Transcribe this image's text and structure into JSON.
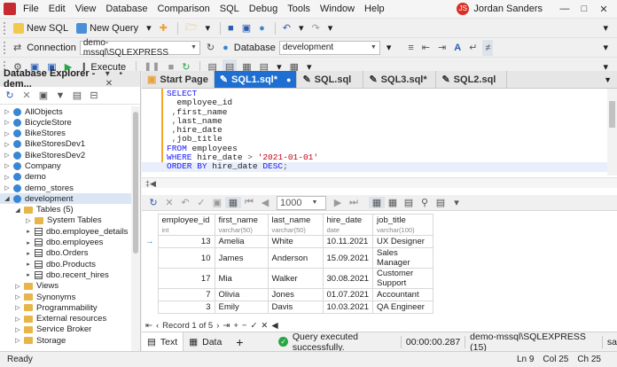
{
  "menu": [
    "File",
    "Edit",
    "View",
    "Database",
    "Comparison",
    "SQL",
    "Debug",
    "Tools",
    "Window",
    "Help"
  ],
  "user": {
    "initials": "JS",
    "name": "Jordan Sanders"
  },
  "toolbar1": {
    "new_sql": "New SQL",
    "new_query": "New Query"
  },
  "toolbar2": {
    "connection_label": "Connection",
    "connection_value": "demo-mssql\\SQLEXPRESS",
    "database_label": "Database",
    "database_value": "development"
  },
  "toolbar3": {
    "execute": "Execute"
  },
  "explorer": {
    "title": "Database Explorer - dem...",
    "items": [
      {
        "label": "AllObjects",
        "type": "db",
        "indent": 0
      },
      {
        "label": "BicycleStore",
        "type": "db",
        "indent": 0
      },
      {
        "label": "BikeStores",
        "type": "db",
        "indent": 0
      },
      {
        "label": "BikeStoresDev1",
        "type": "db",
        "indent": 0
      },
      {
        "label": "BikeStoresDev2",
        "type": "db",
        "indent": 0
      },
      {
        "label": "Company",
        "type": "db",
        "indent": 0
      },
      {
        "label": "demo",
        "type": "db",
        "indent": 0
      },
      {
        "label": "demo_stores",
        "type": "db",
        "indent": 0
      },
      {
        "label": "development",
        "type": "db",
        "indent": 0,
        "expanded": true,
        "selected": true
      },
      {
        "label": "Tables (5)",
        "type": "folder",
        "indent": 1,
        "expanded": true
      },
      {
        "label": "System Tables",
        "type": "folder",
        "indent": 2
      },
      {
        "label": "dbo.employee_details",
        "type": "table",
        "indent": 2
      },
      {
        "label": "dbo.employees",
        "type": "table",
        "indent": 2
      },
      {
        "label": "dbo.Orders",
        "type": "table",
        "indent": 2
      },
      {
        "label": "dbo.Products",
        "type": "table",
        "indent": 2
      },
      {
        "label": "dbo.recent_hires",
        "type": "table",
        "indent": 2
      },
      {
        "label": "Views",
        "type": "folder",
        "indent": 1
      },
      {
        "label": "Synonyms",
        "type": "folder",
        "indent": 1
      },
      {
        "label": "Programmability",
        "type": "folder",
        "indent": 1
      },
      {
        "label": "External resources",
        "type": "folder",
        "indent": 1
      },
      {
        "label": "Service Broker",
        "type": "folder",
        "indent": 1
      },
      {
        "label": "Storage",
        "type": "folder",
        "indent": 1
      }
    ]
  },
  "tabs": [
    "Start Page",
    "SQL1.sql*",
    "SQL.sql",
    "SQL3.sql*",
    "SQL2.sql"
  ],
  "active_tab": 1,
  "code": {
    "l1": "SELECT",
    "l2": "  employee_id",
    "l3a": " ,",
    "l3b": "first_name",
    "l4a": " ,",
    "l4b": "last_name",
    "l5a": " ,",
    "l5b": "hire_date",
    "l6a": " ,",
    "l6b": "job_title",
    "l7a": "FROM",
    "l7b": " employees",
    "l8a": "WHERE",
    "l8b": " hire_date ",
    "l8c": ">",
    "l8d": " '2021-01-01'",
    "l9a": "ORDER BY",
    "l9b": " hire_date ",
    "l9c": "DESC",
    ";": ";"
  },
  "results_toolbar": {
    "page_size": "1000"
  },
  "grid": {
    "columns": [
      {
        "name": "employee_id",
        "type": "int"
      },
      {
        "name": "first_name",
        "type": "varchar(50)"
      },
      {
        "name": "last_name",
        "type": "varchar(50)"
      },
      {
        "name": "hire_date",
        "type": "date"
      },
      {
        "name": "job_title",
        "type": "varchar(100)"
      }
    ],
    "rows": [
      [
        "13",
        "Amelia",
        "White",
        "10.11.2021",
        "UX Designer"
      ],
      [
        "10",
        "James",
        "Anderson",
        "15.09.2021",
        "Sales Manager"
      ],
      [
        "17",
        "Mia",
        "Walker",
        "30.08.2021",
        "Customer Support"
      ],
      [
        "7",
        "Olivia",
        "Jones",
        "01.07.2021",
        "Accountant"
      ],
      [
        "3",
        "Emily",
        "Davis",
        "10.03.2021",
        "QA Engineer"
      ]
    ]
  },
  "record_nav": "Record 1 of 5",
  "bottom": {
    "text_tab": "Text",
    "data_tab": "Data",
    "add": "+",
    "status": "Query executed successfully.",
    "time": "00:00:00.287",
    "server": "demo-mssql\\SQLEXPRESS (15)",
    "user": "sa"
  },
  "statusbar": {
    "ready": "Ready",
    "ln": "Ln 9",
    "col": "Col 25",
    "ch": "Ch 25"
  }
}
